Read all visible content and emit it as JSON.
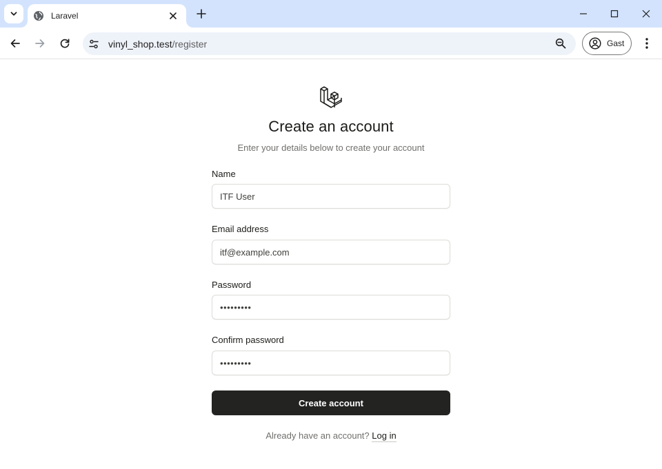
{
  "browser": {
    "tab_title": "Laravel",
    "url_host": "vinyl_shop.test",
    "url_path": "/register",
    "profile_label": "Gast",
    "colors": {
      "tabstrip": "#d3e3fd",
      "omnibox": "#eef2f9"
    }
  },
  "page": {
    "title": "Create an account",
    "subtitle": "Enter your details below to create your account",
    "fields": {
      "name": {
        "label": "Name",
        "value": "ITF User"
      },
      "email": {
        "label": "Email address",
        "value": "itf@example.com"
      },
      "password": {
        "label": "Password",
        "value": "•••••••••"
      },
      "confirm": {
        "label": "Confirm password",
        "value": "•••••••••"
      }
    },
    "submit_label": "Create account",
    "footer_text": "Already have an account?",
    "login_link": "Log in",
    "colors": {
      "button": "#232322",
      "text": "#1b1b18",
      "muted": "#706f6c"
    }
  }
}
